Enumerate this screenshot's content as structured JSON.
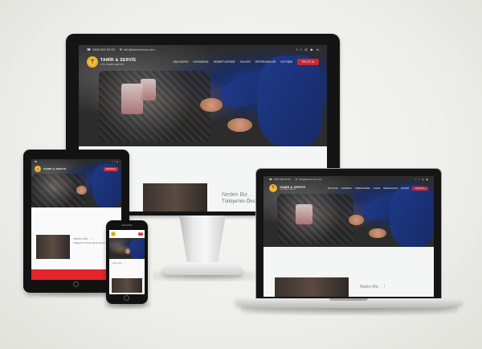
{
  "site": {
    "phone": "0555 555 55 55",
    "email": "info@tamirservis.com",
    "logo_mark": "T",
    "logo_title": "TAMİR & SERVİS",
    "logo_subtitle": "OTO TAMİR SERVİSİ",
    "menu": [
      "ANA SAYFA",
      "KURUMSAL",
      "HİZMETLERİMİZ",
      "GALERİ",
      "REFERANSLAR",
      "İLETİŞİM"
    ],
    "cta_label": "TEKLİF AL",
    "why_title": "Neden Biz . . !",
    "why_subtitle": "Türkiye'nin Öncü Tamir Servisi",
    "social_icons": [
      "facebook-icon",
      "twitter-icon",
      "instagram-icon",
      "youtube-icon",
      "linkedin-icon"
    ]
  },
  "colors": {
    "accent_red": "#e3262b",
    "mechanic_blue": "#1f3a8a",
    "bezel": "#141414",
    "background": "#eeeeea"
  }
}
